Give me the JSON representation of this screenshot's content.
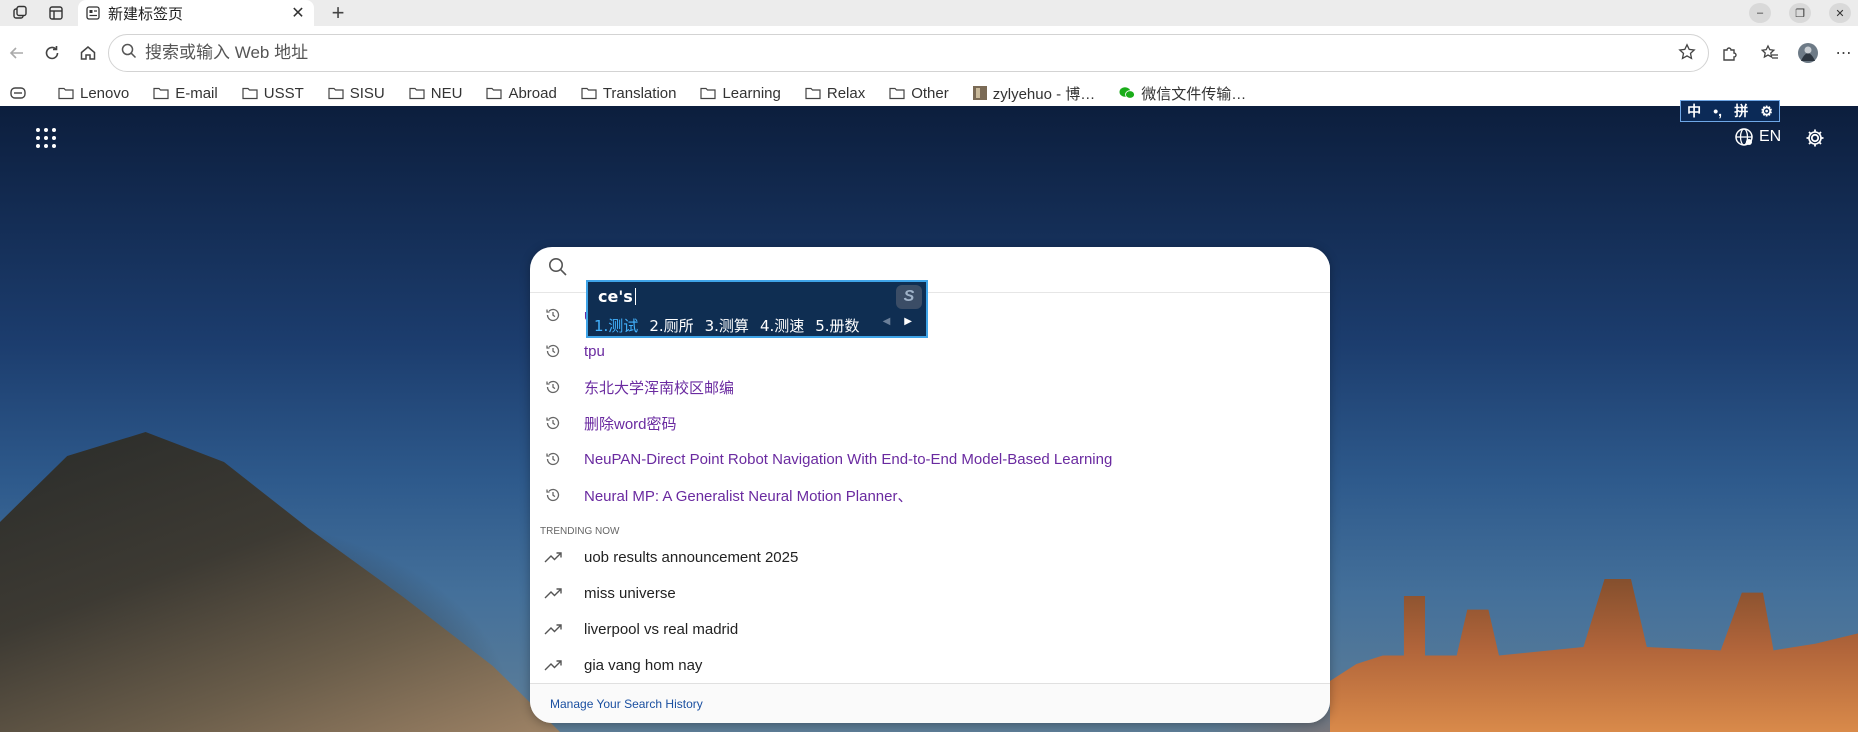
{
  "browser": {
    "tab_title": "新建标签页",
    "new_tab_symbol": "+"
  },
  "toolbar": {
    "address_placeholder": "搜索或输入 Web 地址"
  },
  "bookmarks": [
    "Lenovo",
    "E-mail",
    "USST",
    "SISU",
    "NEU",
    "Abroad",
    "Translation",
    "Learning",
    "Relax",
    "Other",
    "zylyehuo - 博…",
    "微信文件传输…"
  ],
  "newtab": {
    "language": "EN"
  },
  "ime_status": {
    "items": [
      "中",
      "•,",
      "拼",
      "⚙"
    ]
  },
  "search": {
    "history_items": [
      "u",
      "tpu",
      "东北大学浑南校区邮编",
      "删除word密码",
      "NeuPAN-Direct Point Robot Navigation With End-to-End Model-Based Learning",
      "Neural MP: A Generalist Neural Motion Planner、"
    ],
    "trending_header": "TRENDING NOW",
    "trending_items": [
      "uob results announcement 2025",
      "miss universe",
      "liverpool vs real madrid",
      "gia vang hom nay"
    ],
    "footer_link": "Manage Your Search History"
  },
  "ime": {
    "composition": "ce's",
    "candidates": [
      "1.测试",
      "2.厕所",
      "3.测算",
      "4.测速",
      "5.册数"
    ]
  },
  "colors": {
    "history_link": "#6a2aa0",
    "ime_selected": "#43b3ff",
    "ime_background": "#0f2e52"
  }
}
